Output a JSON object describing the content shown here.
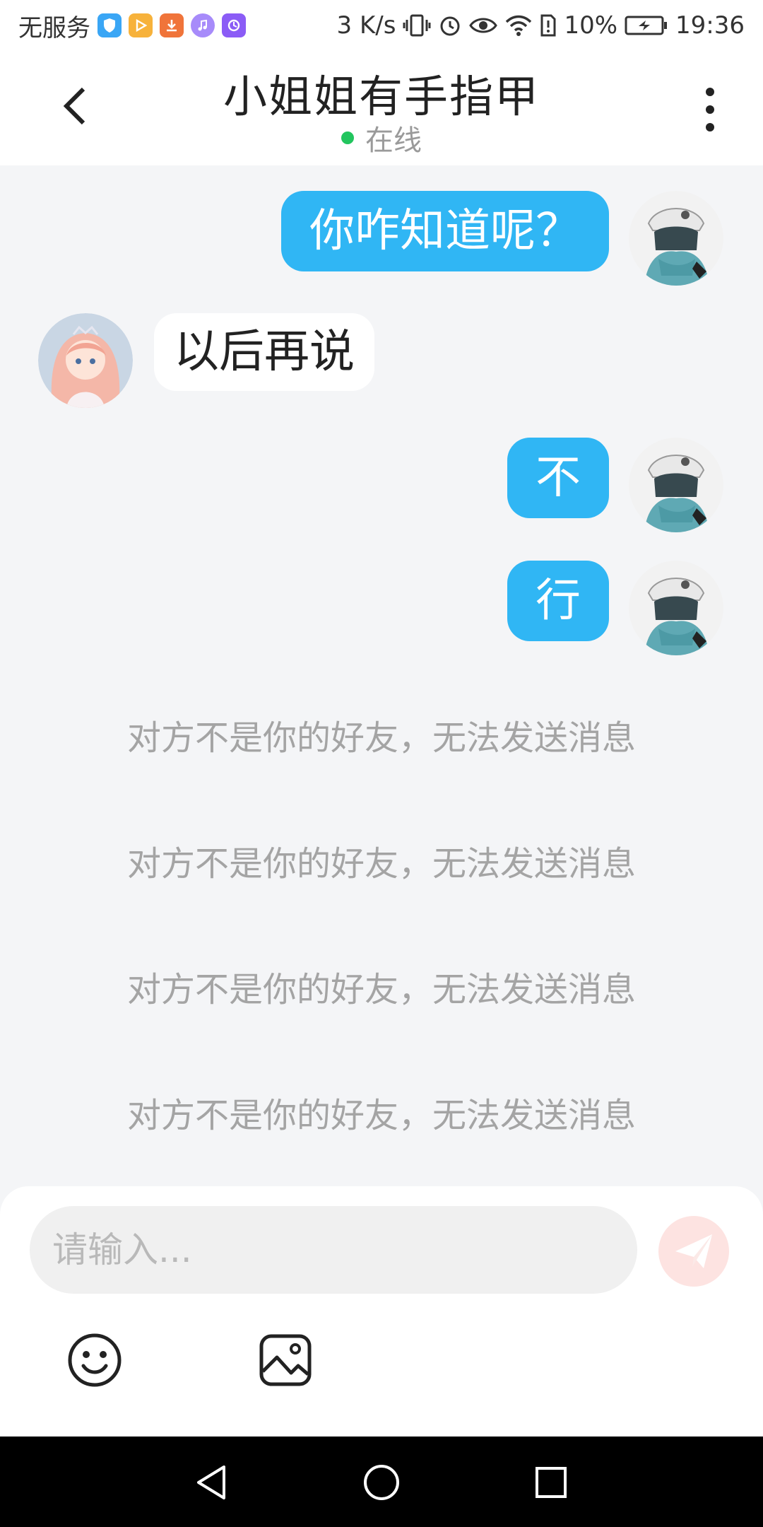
{
  "status_bar": {
    "carrier": "无服务",
    "net_speed": "3 K/s",
    "battery": "10%",
    "time": "19:36"
  },
  "header": {
    "title": "小姐姐有手指甲",
    "status": "在线"
  },
  "messages": [
    {
      "from": "me",
      "text": "你咋知道呢？"
    },
    {
      "from": "other",
      "text": "以后再说"
    },
    {
      "from": "me",
      "text": "不"
    },
    {
      "from": "me",
      "text": "行"
    }
  ],
  "system_messages": [
    "对方不是你的好友，无法发送消息",
    "对方不是你的好友，无法发送消息",
    "对方不是你的好友，无法发送消息",
    "对方不是你的好友，无法发送消息"
  ],
  "composer": {
    "placeholder": "请输入..."
  },
  "colors": {
    "my_bubble": "#30b6f4",
    "online_dot": "#22c55e",
    "send_button": "#fde3e1"
  },
  "icons": [
    "back-icon",
    "more-icon",
    "send-icon",
    "emoji-icon",
    "image-icon",
    "nav-back-icon",
    "nav-home-icon",
    "nav-recent-icon"
  ]
}
